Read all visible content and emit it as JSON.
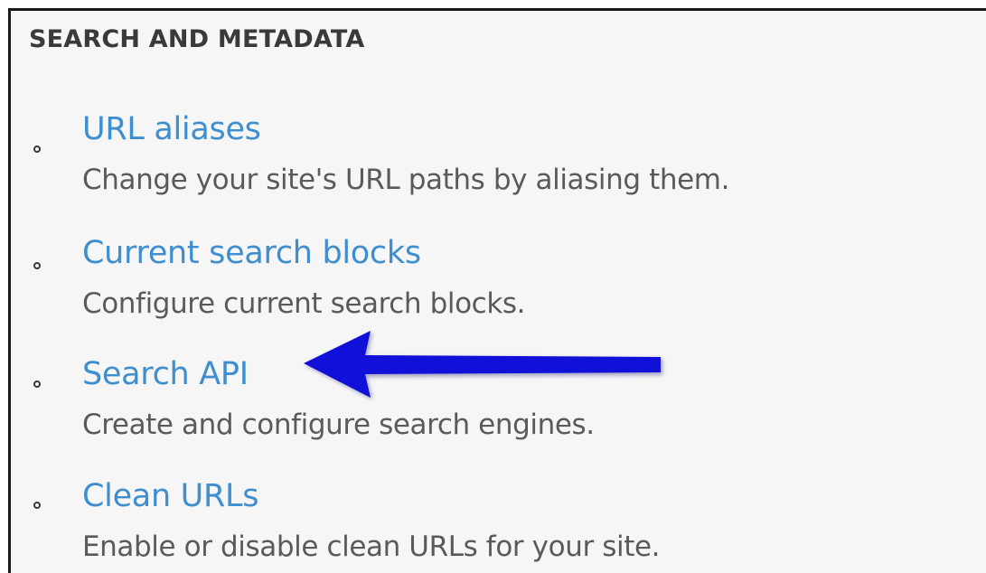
{
  "section": {
    "title": "SEARCH AND METADATA"
  },
  "items": [
    {
      "link": "URL aliases",
      "description": "Change your site's URL paths by aliasing them."
    },
    {
      "link": "Current search blocks",
      "description": "Configure current search blocks."
    },
    {
      "link": "Search API",
      "description": "Create and configure search engines."
    },
    {
      "link": "Clean URLs",
      "description": "Enable or disable clean URLs for your site."
    }
  ],
  "annotation": {
    "icon": "arrow-left-icon",
    "color": "#1010d8",
    "points_to": "Search API"
  },
  "colors": {
    "link": "#3e8ed0",
    "description": "#5a5a5a",
    "title": "#3a3a3a",
    "panel_background": "#f6f6f6"
  }
}
